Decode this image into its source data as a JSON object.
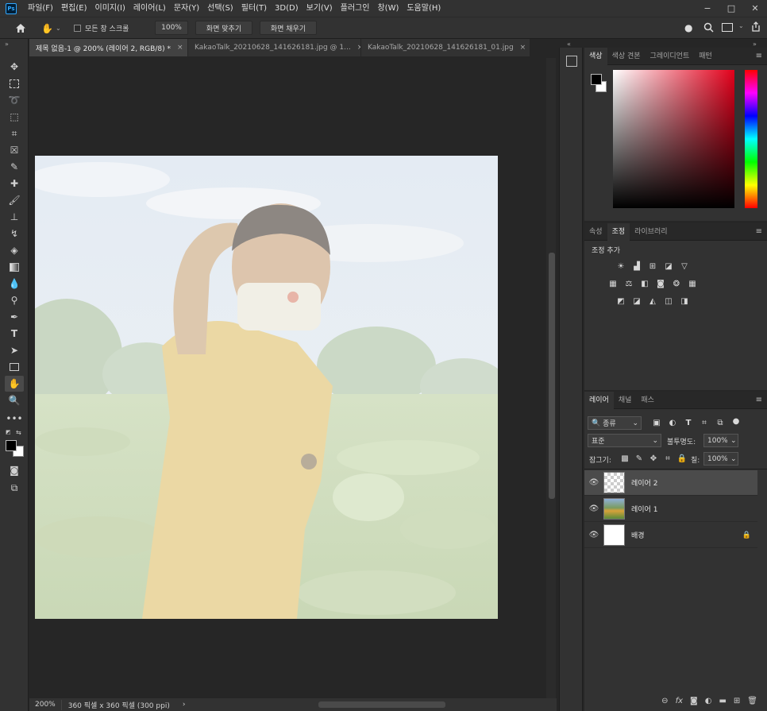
{
  "app": {
    "logo": "Ps"
  },
  "menu": [
    "파일(F)",
    "편집(E)",
    "이미지(I)",
    "레이어(L)",
    "문자(Y)",
    "선택(S)",
    "필터(T)",
    "3D(D)",
    "보기(V)",
    "플러그인",
    "창(W)",
    "도움말(H)"
  ],
  "window_controls": {
    "minimize": "−",
    "maximize": "□",
    "close": "✕"
  },
  "options": {
    "scroll_all_label": "모든 창 스크롤",
    "zoom_value": "100%",
    "fit_screen": "화면 맞추기",
    "fill_screen": "화면 채우기"
  },
  "tabs": [
    {
      "label": "제목 없음-1 @ 200% (레이어 2, RGB/8) *",
      "close": "×"
    },
    {
      "label": "KakaoTalk_20210628_141626181.jpg @ 1...",
      "close": "×"
    },
    {
      "label": "KakaoTalk_20210628_141626181_01.jpg",
      "close": "×"
    }
  ],
  "status": {
    "zoom": "200%",
    "doc_size": "360 픽셀 x 360 픽셀 (300 ppi)",
    "arrow": "›"
  },
  "color_panel": {
    "tabs": [
      "색상",
      "색상 견본",
      "그레이디언트",
      "패턴"
    ],
    "foreground": "#000000",
    "background": "#ffffff"
  },
  "adjust_panel": {
    "tabs": [
      "속성",
      "조정",
      "라이브러리"
    ],
    "title": "조정 추가"
  },
  "layers_panel": {
    "tabs": [
      "레이어",
      "채널",
      "패스"
    ],
    "filter_label": "종류",
    "blend_mode": "표준",
    "opacity_label": "불투명도:",
    "opacity_value": "100%",
    "lock_label": "잠그기:",
    "fill_label": "칠:",
    "fill_value": "100%",
    "layers": [
      {
        "name": "레이어 2",
        "selected": true
      },
      {
        "name": "레이어 1",
        "selected": false
      },
      {
        "name": "배경",
        "selected": false,
        "locked": true
      }
    ]
  },
  "colors": {
    "accent": "#31a8ff",
    "panel": "#323232",
    "canvas_bg": "#262626"
  }
}
